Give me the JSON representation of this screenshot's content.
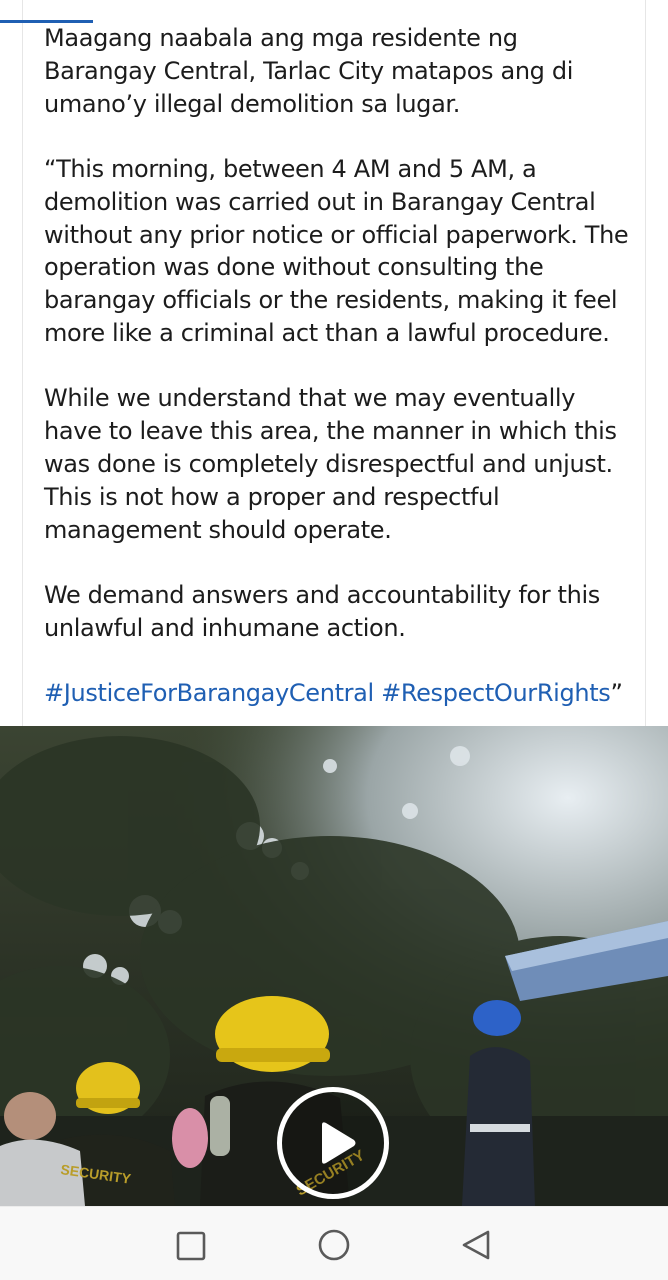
{
  "post": {
    "paragraphs": [
      "Maagang naabala ang mga residente ng Barangay Central, Tarlac City matapos ang di umano’y illegal demolition sa lugar.",
      "“This morning, between 4 AM and 5 AM, a demolition was carried out in Barangay Central without any prior notice or official paperwork. The operation was done without consulting the barangay officials or the residents, making it feel more like a criminal act than a lawful procedure.",
      "While we understand that we may eventually have to leave this area, the manner in which this was done is completely disrespectful and unjust. This is not how a proper and respectful management should operate.",
      "We demand answers and accountability for this unlawful and inhumane action."
    ],
    "hashtag_1": "#JusticeForBarangayCentral",
    "hashtag_2": "#RespectOurRights",
    "closing_quote": "”",
    "link_color": "#1f5fb3"
  },
  "video": {
    "play_icon": "play-icon",
    "helmet_texts": [
      "SECURITY",
      "SECURITY"
    ]
  },
  "navigation_bar": {
    "buttons": [
      "square-recents-icon",
      "circle-home-icon",
      "triangle-back-icon"
    ]
  }
}
